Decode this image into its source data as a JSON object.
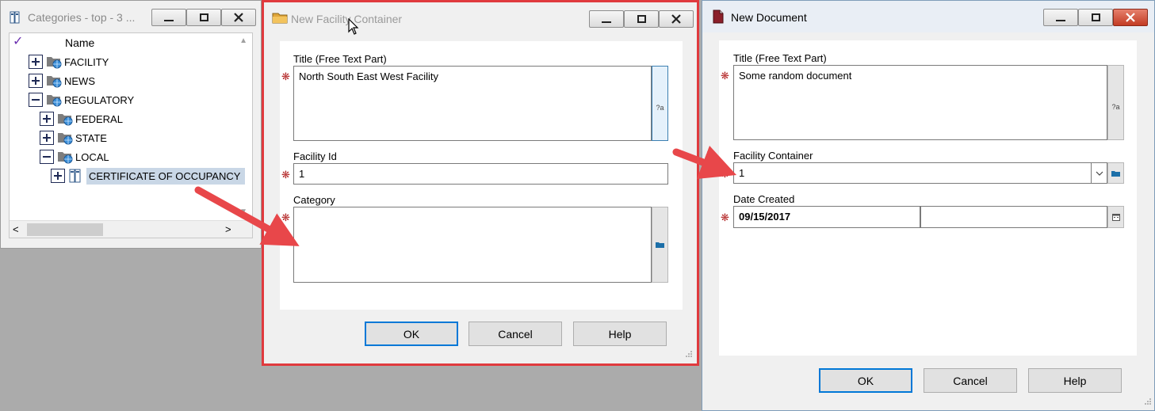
{
  "categories_window": {
    "title": "Categories - top - 3 ...",
    "column_header": "Name",
    "check_mark": "✓",
    "tree": [
      {
        "label": "FACILITY",
        "expander": "+",
        "level": 0
      },
      {
        "label": "NEWS",
        "expander": "+",
        "level": 0
      },
      {
        "label": "REGULATORY",
        "expander": "-",
        "level": 0
      },
      {
        "label": "FEDERAL",
        "expander": "+",
        "level": 1
      },
      {
        "label": "STATE",
        "expander": "+",
        "level": 1
      },
      {
        "label": "LOCAL",
        "expander": "-",
        "level": 1
      },
      {
        "label": "CERTIFICATE OF OCCUPANCY",
        "expander": "+",
        "level": 2,
        "selected": true
      }
    ],
    "scroll_left": "<",
    "scroll_right": ">"
  },
  "facility_dialog": {
    "title": "New Facility Container",
    "title_field_label": "Title (Free Text Part)",
    "title_field_value": "North South East West Facility",
    "facility_id_label": "Facility Id",
    "facility_id_value": "1",
    "category_label": "Category",
    "category_value": "",
    "required_marker": "❋",
    "ok": "OK",
    "cancel": "Cancel",
    "help": "Help"
  },
  "document_dialog": {
    "title": "New Document",
    "title_field_label": "Title (Free Text Part)",
    "title_field_value": "Some random document",
    "facility_container_label": "Facility Container",
    "facility_container_value": "1",
    "date_label": "Date Created",
    "date_value": "09/15/2017",
    "time_value": "",
    "required_marker": "❋",
    "ok": "OK",
    "cancel": "Cancel",
    "help": "Help"
  },
  "colors": {
    "highlight_border": "#e03a3e",
    "arrow": "#e8474a",
    "selection": "#c9d7e6",
    "required": "#b52b2b"
  }
}
